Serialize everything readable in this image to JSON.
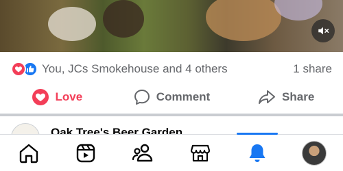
{
  "post": {
    "reactions_text": "You, JCs Smokehouse and 4 others",
    "share_count": "1 share",
    "actions": {
      "love_label": "Love",
      "comment_label": "Comment",
      "share_label": "Share"
    }
  },
  "next_post": {
    "page_name": "Oak Tree's Beer Garden"
  },
  "nav": {
    "items": [
      {
        "icon": "home-icon"
      },
      {
        "icon": "reels-icon"
      },
      {
        "icon": "friends-icon"
      },
      {
        "icon": "marketplace-icon"
      },
      {
        "icon": "notifications-icon",
        "active": true
      },
      {
        "icon": "profile-avatar"
      }
    ]
  },
  "colors": {
    "love": "#f33e58",
    "like": "#1877f2",
    "active": "#1877f2",
    "text_secondary": "#65676b"
  }
}
